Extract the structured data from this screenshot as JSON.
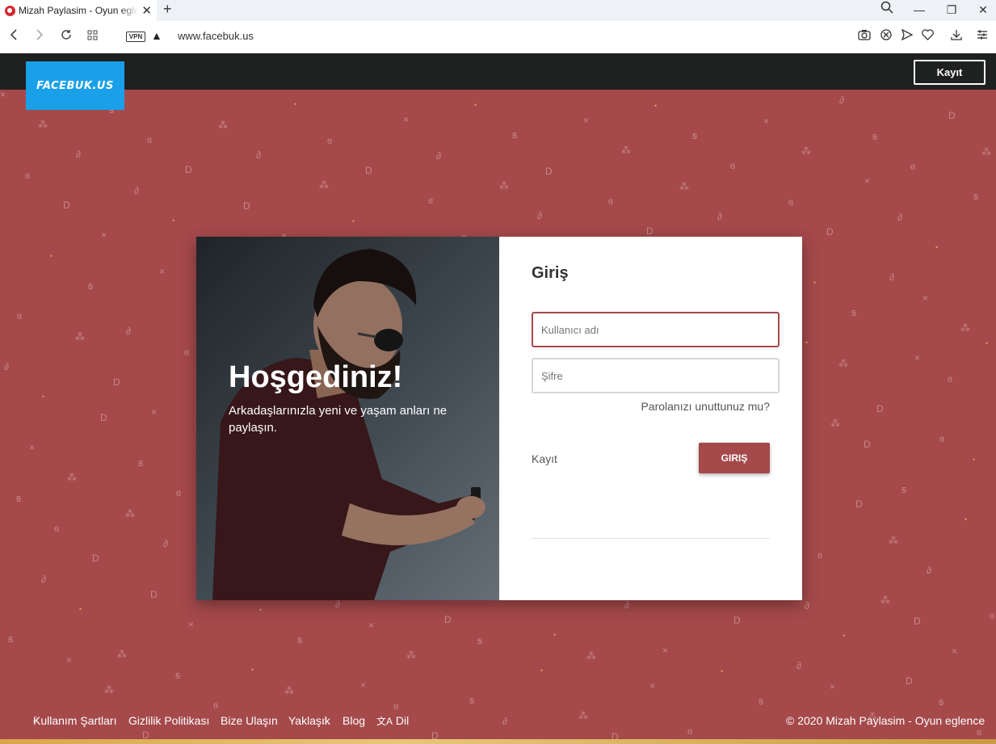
{
  "browser": {
    "tab_title": "Mizah Paylasim - Oyun eglence",
    "url": "www.facebuk.us",
    "vpn_label": "VPN"
  },
  "header": {
    "logo_text": "FACEBUK.US",
    "register_button": "Kayıt"
  },
  "welcome": {
    "title": "Hoşgediniz!",
    "subtitle": "Arkadaşlarınızla yeni ve yaşam anları ne paylaşın."
  },
  "login": {
    "title": "Giriş",
    "username_placeholder": "Kullanıcı adı",
    "password_placeholder": "Şifre",
    "forgot_password": "Parolanızı unuttunuz mu?",
    "register_link": "Kayıt",
    "submit_button": "GIRIŞ"
  },
  "footer": {
    "links": [
      "Kullanım Şartları",
      "Gizlilik Politikası",
      "Bize Ulaşın",
      "Yaklaşık",
      "Blog",
      "Dil"
    ],
    "copyright": "© 2020 Mizah Paylasim - Oyun eglence"
  },
  "colors": {
    "background": "#a5494b",
    "header": "#1f2020",
    "logo": "#1aa0e8",
    "accent": "#a5494b"
  }
}
